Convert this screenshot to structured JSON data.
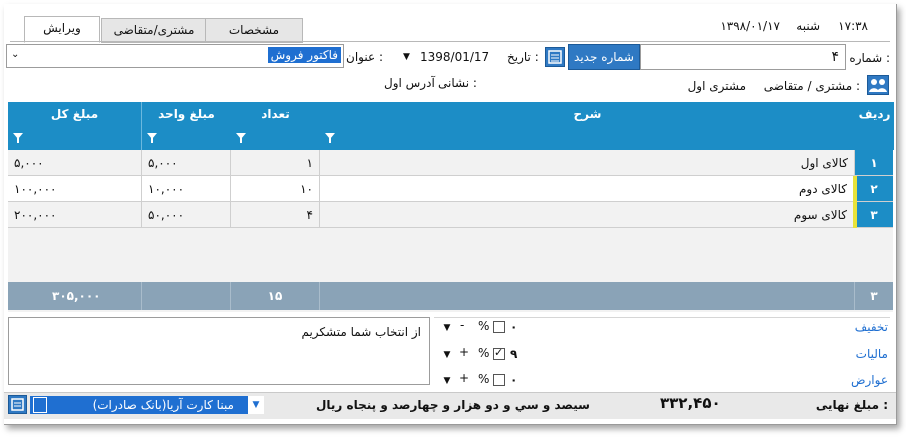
{
  "header": {
    "time": "۱۷:۳۸",
    "weekday": "شنبه",
    "date": "۱۳۹۸/۰۱/۱۷"
  },
  "tabs": [
    {
      "label": "ویرایش",
      "active": true
    },
    {
      "label": "مشتری/متقاضی",
      "active": false
    },
    {
      "label": "مشخصات",
      "active": false
    }
  ],
  "form": {
    "number_label": "شماره :",
    "number_value": "۴",
    "new_number_button": "شماره جدید",
    "date_label": "تاریخ :",
    "date_value": "1398/01/17",
    "title_label": "عنوان :",
    "title_value": "فاکتور فروش",
    "customer_label": "مشتری / متقاضی :",
    "customer_value": "مشتری اول",
    "address_label": "نشانی :",
    "address_value": "آدرس اول"
  },
  "grid": {
    "columns": {
      "row": "ردیف",
      "desc": "شرح",
      "qty": "تعداد",
      "unit_price": "مبلغ واحد",
      "total": "مبلغ کل"
    },
    "rows": [
      {
        "no": "۱",
        "desc": "کالای اول",
        "qty": "۱",
        "unit_price": "۵,۰۰۰",
        "total": "۵,۰۰۰"
      },
      {
        "no": "۲",
        "desc": "کالای دوم",
        "qty": "۱۰",
        "unit_price": "۱۰,۰۰۰",
        "total": "۱۰۰,۰۰۰"
      },
      {
        "no": "۳",
        "desc": "کالای سوم",
        "qty": "۴",
        "unit_price": "۵۰,۰۰۰",
        "total": "۲۰۰,۰۰۰"
      }
    ],
    "footer": {
      "count": "۳",
      "qty": "۱۵",
      "total": "۳۰۵,۰۰۰"
    }
  },
  "notes": "از انتخاب شما متشکریم",
  "adjustments": [
    {
      "label": "تخفیف",
      "value": "۰",
      "percent": "%",
      "sign": "-",
      "checked": false
    },
    {
      "label": "مالیات",
      "value": "۹",
      "percent": "%",
      "sign": "+",
      "checked": true
    },
    {
      "label": "عوارض",
      "value": "۰",
      "percent": "%",
      "sign": "+",
      "checked": false
    }
  ],
  "final": {
    "label": "مبلغ نهایی :",
    "amount": "۳۳۲,۴۵۰",
    "words": "سیصد و سي و دو هزار و چهارصد و پنجاه ریال"
  },
  "bank": "مبنا کارت آریا(بانک صادرات)",
  "colors": {
    "header_blue": "#1c8dc6",
    "accent_blue": "#1f6fd1",
    "footer_gray": "#8aa3b7",
    "row_marker": "#e8e23a"
  }
}
